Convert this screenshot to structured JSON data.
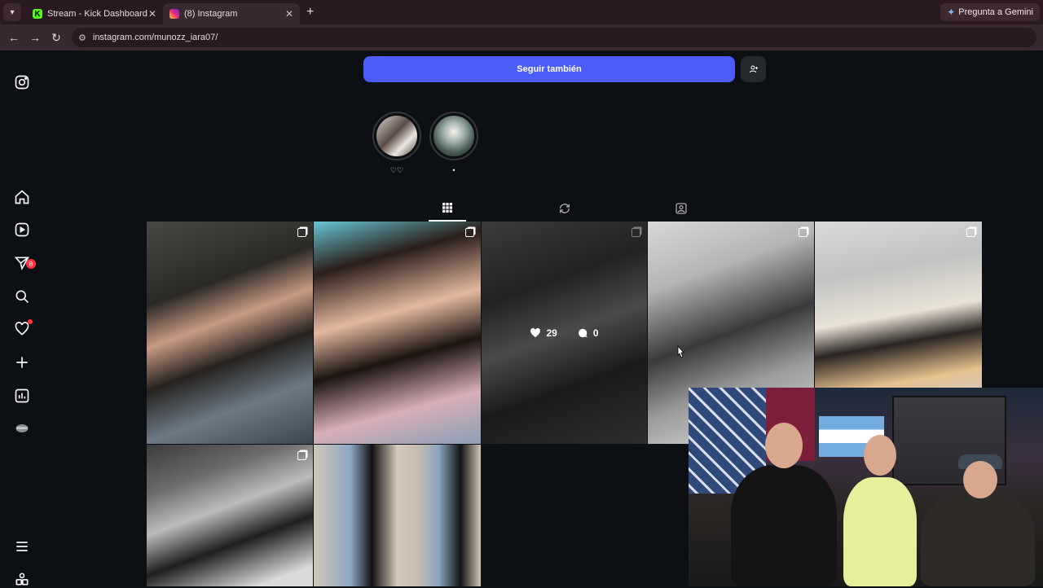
{
  "browser": {
    "tabs": [
      {
        "title": "Stream - Kick Dashboard",
        "active": false,
        "favicon": "kick-icon"
      },
      {
        "title": "(8) Instagram",
        "active": true,
        "favicon": "instagram-icon"
      }
    ],
    "gemini_label": "Pregunta a Gemini",
    "url": "instagram.com/munozz_iara07/"
  },
  "sidebar": {
    "items": [
      "instagram-logo",
      "home-icon",
      "reels-icon",
      "messages-icon",
      "search-icon",
      "notifications-icon",
      "create-icon",
      "dashboard-icon",
      "profile-avatar",
      "more-icon",
      "also-from-meta-icon"
    ],
    "messages_badge": "8"
  },
  "profile": {
    "follow_button": "Seguir también",
    "highlights": [
      {
        "label": "♡♡"
      },
      {
        "label": "•"
      }
    ],
    "tabs": [
      "posts-grid-icon",
      "reposts-icon",
      "tagged-icon"
    ],
    "active_tab": "posts"
  },
  "posts": [
    {
      "multi": true
    },
    {
      "multi": true
    },
    {
      "multi": true,
      "hover": true,
      "likes": "29",
      "comments": "0"
    },
    {
      "multi": true
    },
    {
      "multi": true
    },
    {
      "multi": true
    },
    {
      "multi": false
    }
  ],
  "colors": {
    "background": "#0c1014",
    "follow_button": "#4a5df9",
    "badge": "#ff3040",
    "browser_frame": "#2a1a20"
  }
}
